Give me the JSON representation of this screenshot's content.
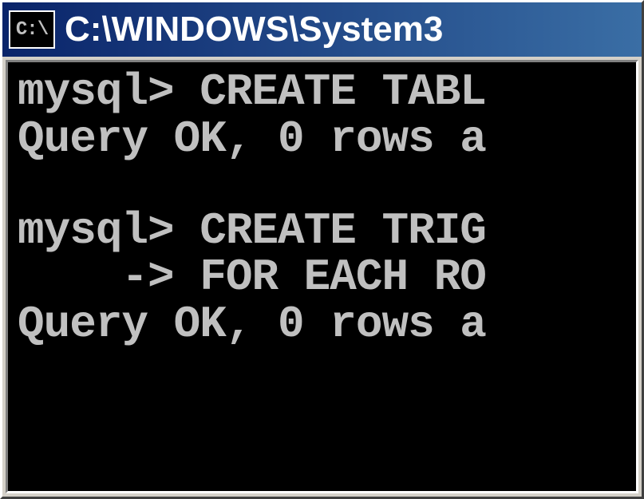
{
  "window": {
    "icon_label": "C:\\",
    "title": "C:\\WINDOWS\\System3"
  },
  "terminal": {
    "lines": [
      "mysql> CREATE TABL",
      "Query OK, 0 rows a",
      "",
      "mysql> CREATE TRIG",
      "    -> FOR EACH RO",
      "Query OK, 0 rows a"
    ]
  }
}
